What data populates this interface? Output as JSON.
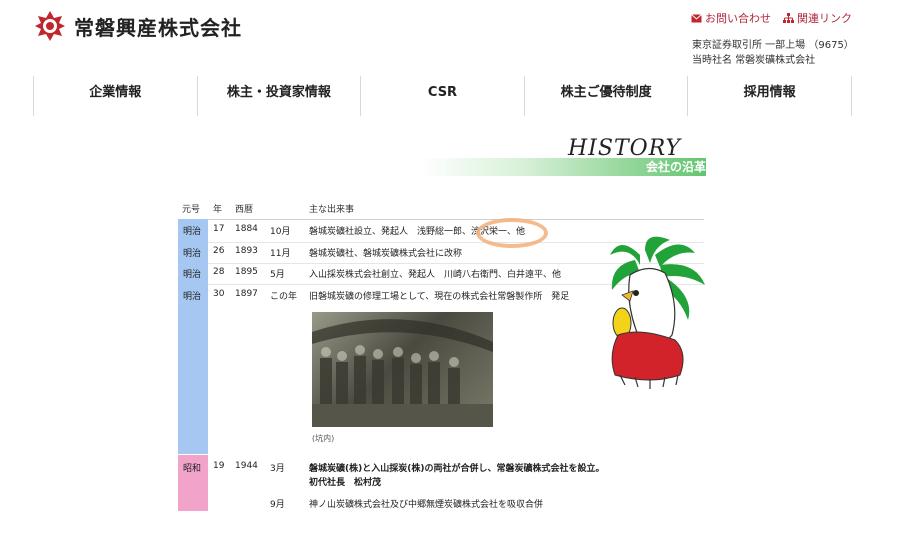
{
  "header": {
    "company_name": "常磐興産株式会社",
    "links": {
      "contact": "お問い合わせ",
      "related": "関連リンク"
    },
    "exchange": "東京証券取引所 一部上場 （9675）",
    "former_name": "当時社名 常磐炭礦株式会社"
  },
  "nav": {
    "items": [
      {
        "label": "企業情報"
      },
      {
        "label": "株主・投資家情報"
      },
      {
        "label": "CSR"
      },
      {
        "label": "株主ご優待制度"
      },
      {
        "label": "採用情報"
      }
    ]
  },
  "history": {
    "title": "HISTORY",
    "subtitle": "会社の沿革",
    "columns": {
      "era": "元号",
      "year": "年",
      "western": "西暦",
      "event": "主な出来事"
    },
    "rows": [
      {
        "era": "明治",
        "year": "17",
        "western": "1884",
        "month": "10月",
        "event": "磐城炭礦社設立、発起人　浅野総一郎、渋沢栄一、他"
      },
      {
        "era": "明治",
        "year": "26",
        "western": "1893",
        "month": "11月",
        "event": "磐城炭礦社、磐城炭礦株式会社に改称"
      },
      {
        "era": "明治",
        "year": "28",
        "western": "1895",
        "month": "5月",
        "event": "入山採炭株式会社創立、発起人　川崎八右衛門、白井遠平、他"
      },
      {
        "era": "明治",
        "year": "30",
        "western": "1897",
        "month": "この年",
        "event": "旧磐城炭礦の修理工場として、現在の株式会社常磐製作所　発足"
      },
      {
        "era": "昭和",
        "year": "19",
        "western": "1944",
        "month": "3月",
        "event": "磐城炭礦(株)と入山採炭(株)の両社が合併し、常磐炭礦株式会社を設立。",
        "event2": "初代社長　松村茂"
      },
      {
        "month": "9月",
        "event": "神ノ山炭礦株式会社及び中郷無煙炭礦株式会社を吸収合併"
      }
    ],
    "photo_caption": "(坑内)"
  },
  "colors": {
    "accent_red": "#c0262d",
    "era_blue": "#a5c7f1",
    "era_pink": "#f1a3c9",
    "green": "#63c46e"
  }
}
